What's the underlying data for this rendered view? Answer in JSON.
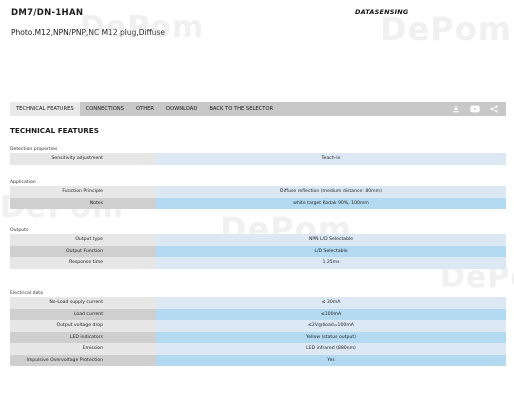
{
  "header": {
    "product_code": "DM7/DN-1HAN",
    "product_desc": "Photo.M12,NPN/PNP,NC M12 plug,Diffuse",
    "brand": "DATASENSING"
  },
  "watermark": "DePom",
  "tabs": [
    {
      "label": "TECHNICAL FEATURES",
      "active": true
    },
    {
      "label": "CONNECTIONS"
    },
    {
      "label": "OTHER"
    },
    {
      "label": "DOWNLOAD"
    },
    {
      "label": "BACK TO THE SELECTOR"
    }
  ],
  "tab_icons": [
    "download-icon",
    "youtube-icon",
    "share-icon"
  ],
  "section_title": "TECHNICAL FEATURES",
  "groups": [
    {
      "title": "Detection properties",
      "rows": [
        {
          "label": "Sensitivity adjustment",
          "value": "Teach-in"
        }
      ]
    },
    {
      "title": "Application",
      "rows": [
        {
          "label": "Function Principle",
          "value": "Diffuse reflection (medium distance: 80mm)"
        },
        {
          "label": "Notes",
          "value": "white target Kodak 90%, 100mm"
        }
      ]
    },
    {
      "title": "Outputs",
      "rows": [
        {
          "label": "Output type",
          "value": "NPN L/D Selectable"
        },
        {
          "label": "Output Function",
          "value": "L/D Selectable"
        },
        {
          "label": "Response time",
          "value": "1.25ms"
        }
      ]
    },
    {
      "title": "Electrical data",
      "rows": [
        {
          "label": "No-Load supply current",
          "value": "≤ 30mA"
        },
        {
          "label": "Load current",
          "value": "≤100mA"
        },
        {
          "label": "Output voltage drop",
          "value": "≤2V@Iload=100mA"
        },
        {
          "label": "LED indicators",
          "value": "Yellow (status output)"
        },
        {
          "label": "Emission",
          "value": "LED infrared (880nm)"
        },
        {
          "label": "Impulsive Overvoltage Protection",
          "value": "Yes"
        }
      ]
    }
  ],
  "colors": {
    "tabbar": "#c8c8c8",
    "row_value_light": "#dce9f5",
    "row_value_dark": "#b3daf1",
    "watermark_accent": "#e03a1e"
  }
}
